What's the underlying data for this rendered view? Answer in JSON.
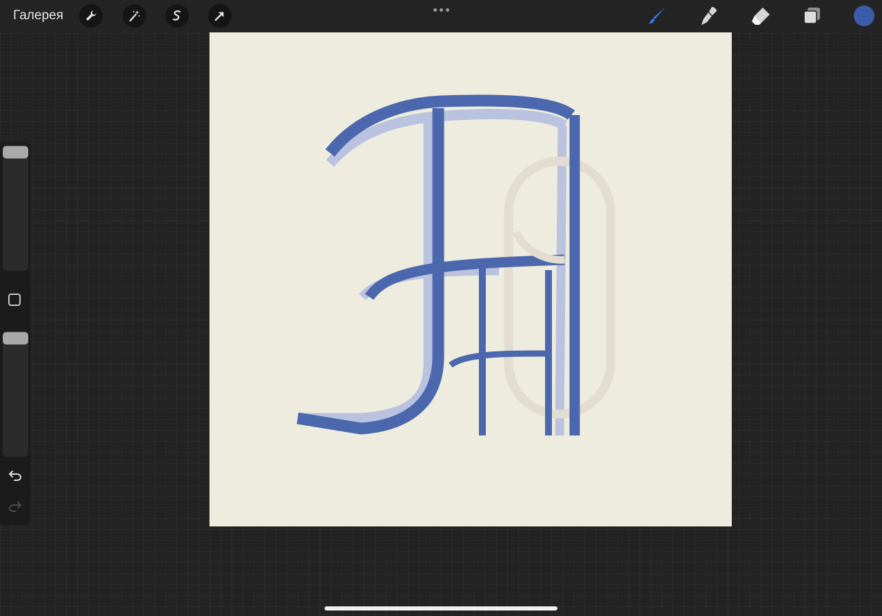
{
  "topbar": {
    "gallery_label": "Галерея",
    "left_tools": [
      "wrench-icon",
      "magic-wand-icon",
      "selection-icon",
      "transform-arrow-icon"
    ],
    "more_icon": "ellipsis-icon",
    "right_tools": [
      "brush-icon",
      "smudge-icon",
      "eraser-icon",
      "layers-icon"
    ],
    "active_tool": "brush",
    "accent_color": "#2f7ff6",
    "current_color": "#3c5ba8"
  },
  "sidebar": {
    "brush_size_icon": "slider-thumb",
    "modify_icon": "square-icon",
    "opacity_icon": "slider-thumb",
    "undo_icon": "undo-icon",
    "redo_icon": "redo-icon"
  },
  "canvas": {
    "background": "#eeecde",
    "stroke_color": "#4b67ad",
    "shadow_color": "#b9c2de",
    "ring_color": "#e3ddd1"
  }
}
